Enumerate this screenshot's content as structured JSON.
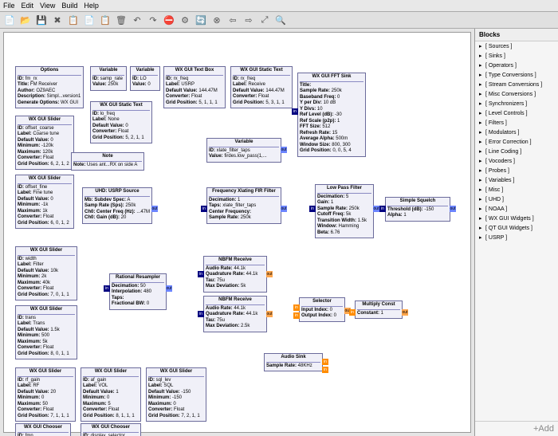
{
  "menubar": [
    "File",
    "Edit",
    "View",
    "Build",
    "Help"
  ],
  "toolbar_icons": [
    "📄",
    "📂",
    "💾",
    "✖",
    "📋",
    "📄",
    "📋",
    "🗑",
    "↶",
    "↷",
    "⛔",
    "⚙",
    "🔄",
    "⊗",
    "⇦",
    "⇨",
    "⤢",
    "🔍"
  ],
  "sidebar": {
    "title": "Blocks",
    "items": [
      "[ Sources ]",
      "[ Sinks ]",
      "[ Operators ]",
      "[ Type Conversions ]",
      "[ Stream Conversions ]",
      "[ Misc Conversions ]",
      "[ Synchronizers ]",
      "[ Level Controls ]",
      "[ Filters ]",
      "[ Modulators ]",
      "[ Error Correction ]",
      "[ Line Coding ]",
      "[ Vocoders ]",
      "[ Probes ]",
      "[ Variables ]",
      "[ Misc ]",
      "[ UHD ]",
      "[ NOAA ]",
      "[ WX GUI Widgets ]",
      "[ QT GUI Widgets ]",
      "[ USRP ]"
    ],
    "add": "+Add"
  },
  "blocks": {
    "options": {
      "title": "Options",
      "lines": [
        "<b>ID:</b> fm_rx",
        "<b>Title:</b> FM Receiver",
        "<b>Author:</b> OZ9AEC",
        "<b>Description:</b> Simpl...version1",
        "<b>Generate Options:</b> WX GUI"
      ]
    },
    "var_samp": {
      "title": "Variable",
      "lines": [
        "<b>ID:</b> samp_rate",
        "<b>Value:</b> 250k"
      ]
    },
    "var_lo": {
      "title": "Variable",
      "lines": [
        "<b>ID:</b> LO",
        "<b>Value:</b> 0"
      ]
    },
    "textbox": {
      "title": "WX GUI Text Box",
      "lines": [
        "<b>ID:</b> rx_freq",
        "<b>Label:</b> USRP",
        "<b>Default Value:</b> 144.47M",
        "<b>Converter:</b> Float",
        "<b>Grid Position:</b> 5, 1, 1, 1"
      ]
    },
    "static_rx": {
      "title": "WX GUI Static Text",
      "lines": [
        "<b>ID:</b> rx_freq",
        "<b>Label:</b> Receive",
        "<b>Default Value:</b> 144.47M",
        "<b>Converter:</b> Float",
        "<b>Grid Position:</b> 5, 3, 1, 1"
      ]
    },
    "fft": {
      "title": "WX GUI FFT Sink",
      "lines": [
        "<b>Title:</b>",
        "<b>Sample Rate:</b> 250k",
        "<b>Baseband Freq:</b> 0",
        "<b>Y per Div:</b> 10 dB",
        "<b>Y Divs:</b> 10",
        "<b>Ref Level (dB):</b> -30",
        "<b>Ref Scale (p2p):</b> 1",
        "<b>FFT Size:</b> 512",
        "<b>Refresh Rate:</b> 15",
        "<b>Average Alpha:</b> 500m",
        "<b>Window Size:</b> 800, 300",
        "<b>Grid Position:</b> 0, 0, 5, 4"
      ]
    },
    "static_lo": {
      "title": "WX GUI Static Text",
      "lines": [
        "<b>ID:</b> lo_freq",
        "<b>Label:</b> None",
        "<b>Default Value:</b> 0",
        "<b>Converter:</b> Float",
        "<b>Grid Position:</b> 5, 2, 1, 1"
      ]
    },
    "slider_coarse": {
      "title": "WX GUI Slider",
      "lines": [
        "<b>ID:</b> offset_coarse",
        "<b>Label:</b> Coarse tune",
        "<b>Default Value:</b> 0",
        "<b>Minimum:</b> -120k",
        "<b>Maximum:</b> 120k",
        "<b>Converter:</b> Float",
        "<b>Grid Position:</b> 6, 2, 1, 2"
      ]
    },
    "note": {
      "title": "Note",
      "lines": [
        "<b>Note:</b> Uses ant...RX on side A"
      ]
    },
    "var_taps": {
      "title": "Variable",
      "lines": [
        "<b>ID:</b> xlate_filter_taps",
        "<b>Value:</b> firdes.low_pass(1,..."
      ]
    },
    "slider_fine": {
      "title": "WX GUI Slider",
      "lines": [
        "<b>ID:</b> offset_fine",
        "<b>Label:</b> Fine tune",
        "<b>Default Value:</b> 0",
        "<b>Minimum:</b> -1k",
        "<b>Maximum:</b> 1k",
        "<b>Converter:</b> Float",
        "<b>Grid Position:</b> 6, 0, 1, 2"
      ]
    },
    "usrp": {
      "title": "UHD: USRP Source",
      "lines": [
        "<b>Mb: Subdev Spec:</b> A",
        "<b>Samp Rate (Sps):</b> 250k",
        "<b>Ch0: Center Freq (Hz):</b> ...47M",
        "<b>Ch0: Gain (dB):</b> 20"
      ]
    },
    "fir": {
      "title": "Frequency Xlating FIR Filter",
      "lines": [
        "<b>Decimation:</b> 1",
        "<b>Taps:</b> xlate_filter_taps",
        "<b>Center Frequency:</b>",
        "<b>Sample Rate:</b> 250k"
      ]
    },
    "lpf": {
      "title": "Low Pass Filter",
      "lines": [
        "<b>Decimation:</b> 5",
        "<b>Gain:</b> 1",
        "<b>Sample Rate:</b> 250k",
        "<b>Cutoff Freq:</b> 5k",
        "<b>Transition Width:</b> 1.5k",
        "<b>Window:</b> Hamming",
        "<b>Beta:</b> 6.76"
      ]
    },
    "squelch": {
      "title": "Simple Squelch",
      "lines": [
        "<b>Threshold (dB):</b> -150",
        "<b>Alpha:</b> 1"
      ]
    },
    "slider_width": {
      "title": "WX GUI Slider",
      "lines": [
        "<b>ID:</b> width",
        "<b>Label:</b> Filter",
        "<b>Default Value:</b> 10k",
        "<b>Minimum:</b> 2k",
        "<b>Maximum:</b> 40k",
        "<b>Converter:</b> Float",
        "<b>Grid Position:</b> 7, 0, 1, 1"
      ]
    },
    "resamp": {
      "title": "Rational Resampler",
      "lines": [
        "<b>Decimation:</b> 50",
        "<b>Interpolation:</b> 480",
        "<b>Taps:</b>",
        "<b>Fractional BW:</b> 0"
      ]
    },
    "nbfm1": {
      "title": "NBFM Receive",
      "lines": [
        "<b>Audio Rate:</b> 44.1k",
        "<b>Quadrature Rate:</b> 44.1k",
        "<b>Tau:</b> 75u",
        "<b>Max Deviation:</b> 5k"
      ]
    },
    "nbfm2": {
      "title": "NBFM Receive",
      "lines": [
        "<b>Audio Rate:</b> 44.1k",
        "<b>Quadrature Rate:</b> 44.1k",
        "<b>Tau:</b> 75u",
        "<b>Max Deviation:</b> 2.5k"
      ]
    },
    "selector": {
      "title": "Selector",
      "lines": [
        "<b>Input Index:</b> 0",
        "<b>Output Index:</b> 0"
      ]
    },
    "mult": {
      "title": "Multiply Const",
      "lines": [
        "<b>Constant:</b> 1"
      ]
    },
    "slider_trans": {
      "title": "WX GUI Slider",
      "lines": [
        "<b>ID:</b> trans",
        "<b>Label:</b> Trans",
        "<b>Default Value:</b> 1.5k",
        "<b>Minimum:</b> 500",
        "<b>Maximum:</b> 5k",
        "<b>Converter:</b> Float",
        "<b>Grid Position:</b> 8, 0, 1, 1"
      ]
    },
    "audio": {
      "title": "Audio Sink",
      "lines": [
        "<b>Sample Rate:</b> 48KHz"
      ]
    },
    "slider_rf": {
      "title": "WX GUI Slider",
      "lines": [
        "<b>ID:</b> rf_gain",
        "<b>Label:</b> RF",
        "<b>Default Value:</b> 20",
        "<b>Minimum:</b> 0",
        "<b>Maximum:</b> 50",
        "<b>Converter:</b> Float",
        "<b>Grid Position:</b> 7, 1, 1, 1"
      ]
    },
    "slider_af": {
      "title": "WX GUI Slider",
      "lines": [
        "<b>ID:</b> af_gain",
        "<b>Label:</b> VOL",
        "<b>Default Value:</b> 1",
        "<b>Minimum:</b> 0",
        "<b>Maximum:</b> 5",
        "<b>Converter:</b> Float",
        "<b>Grid Position:</b> 8, 1, 1, 1"
      ]
    },
    "slider_sql": {
      "title": "WX GUI Slider",
      "lines": [
        "<b>ID:</b> sql_lev",
        "<b>Label:</b> SQL",
        "<b>Default Value:</b> -150",
        "<b>Minimum:</b> -150",
        "<b>Maximum:</b> 0",
        "<b>Converter:</b> Float",
        "<b>Grid Position:</b> 7, 2, 1, 1"
      ]
    },
    "chooser_fmn": {
      "title": "WX GUI Chooser",
      "lines": [
        "<b>ID:</b> fmn"
      ]
    },
    "chooser_disp": {
      "title": "WX GUI Chooser",
      "lines": [
        "<b>ID:</b> display_selector"
      ]
    }
  }
}
